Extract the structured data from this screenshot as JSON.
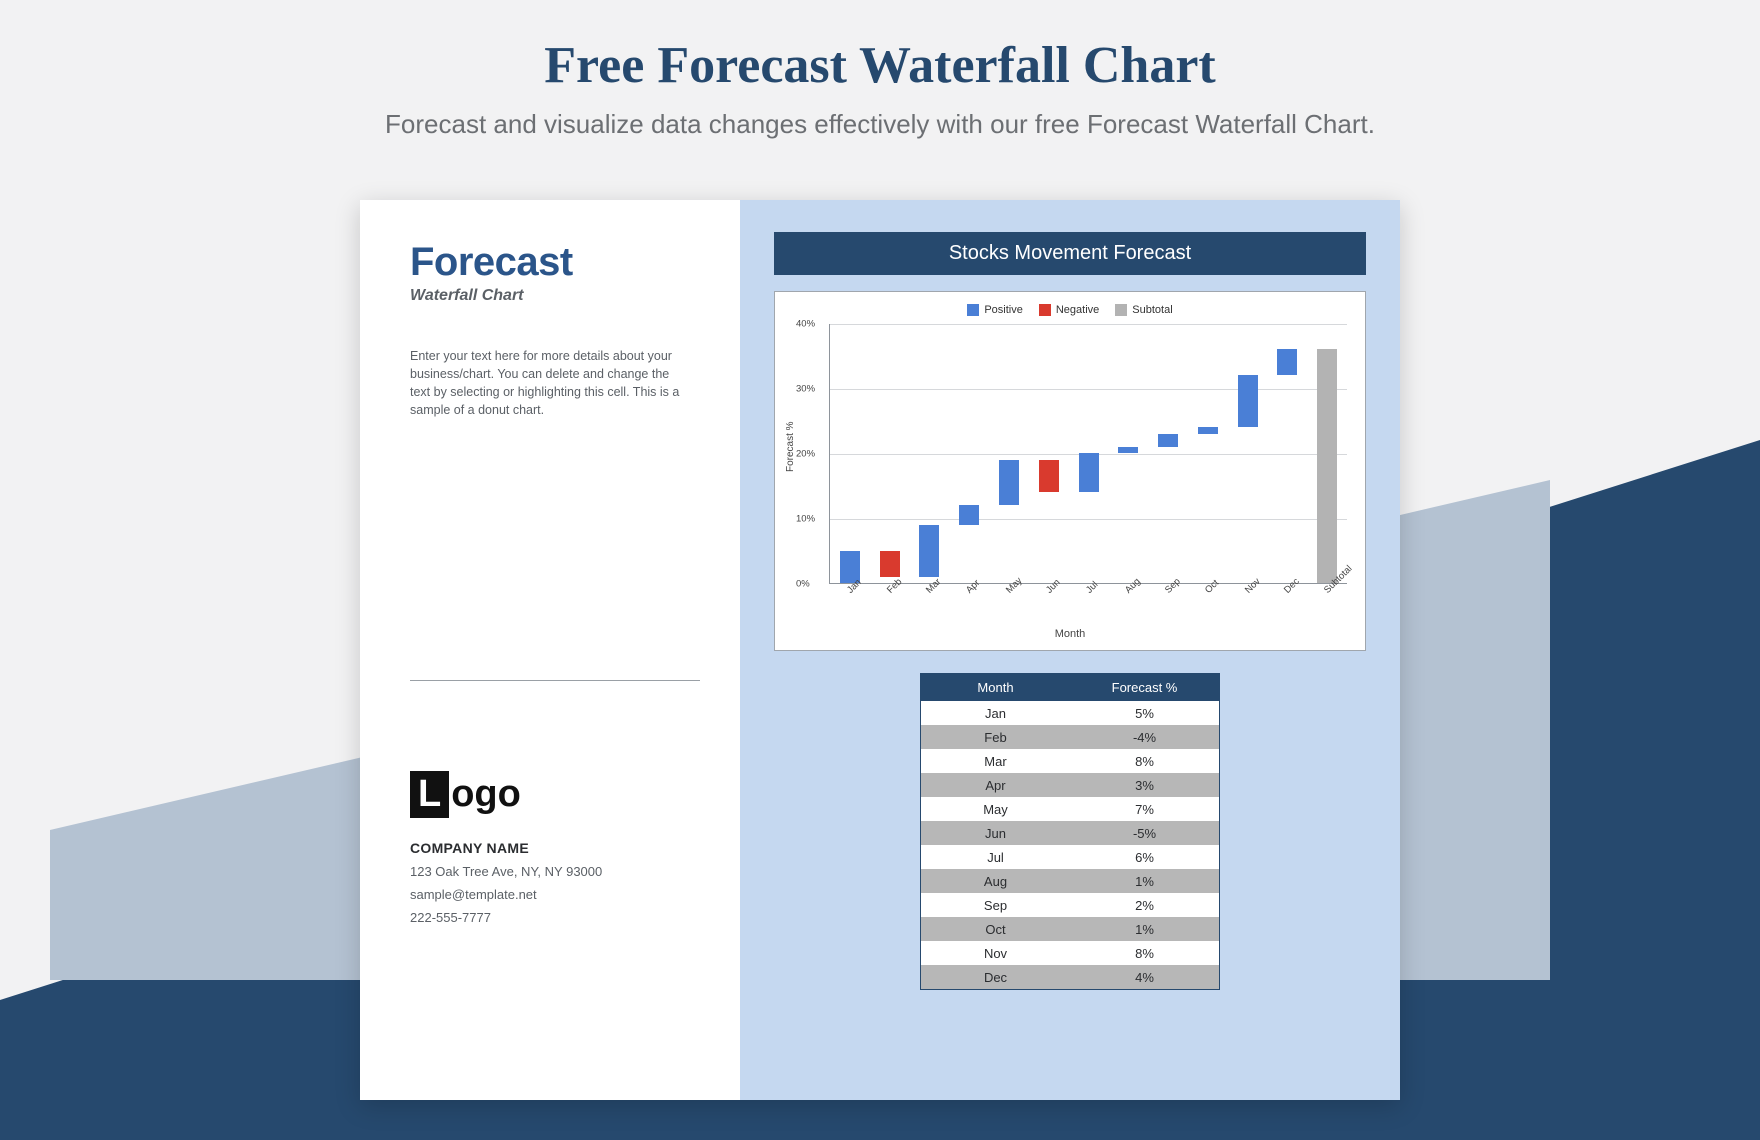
{
  "page": {
    "title": "Free Forecast Waterfall Chart",
    "subtitle": "Forecast and visualize data changes effectively with our free Forecast Waterfall Chart."
  },
  "left": {
    "title": "Forecast",
    "subtitle": "Waterfall Chart",
    "description": "Enter your text here for more details about your business/chart. You can delete and change the text by selecting or highlighting this cell. This is a sample of a donut chart.",
    "logo_l": "L",
    "logo_rest": "ogo",
    "company_name": "COMPANY NAME",
    "address": "123 Oak Tree Ave, NY, NY 93000",
    "email": "sample@template.net",
    "phone": "222-555-7777"
  },
  "chart": {
    "title": "Stocks Movement Forecast",
    "legend": {
      "positive": "Positive",
      "negative": "Negative",
      "subtotal": "Subtotal"
    },
    "ylabel": "Forecast %",
    "xlabel": "Month",
    "yticks": [
      "0%",
      "10%",
      "20%",
      "30%",
      "40%"
    ]
  },
  "table": {
    "headers": [
      "Month",
      "Forecast %"
    ],
    "rows": [
      [
        "Jan",
        "5%"
      ],
      [
        "Feb",
        "-4%"
      ],
      [
        "Mar",
        "8%"
      ],
      [
        "Apr",
        "3%"
      ],
      [
        "May",
        "7%"
      ],
      [
        "Jun",
        "-5%"
      ],
      [
        "Jul",
        "6%"
      ],
      [
        "Aug",
        "1%"
      ],
      [
        "Sep",
        "2%"
      ],
      [
        "Oct",
        "1%"
      ],
      [
        "Nov",
        "8%"
      ],
      [
        "Dec",
        "4%"
      ]
    ]
  },
  "chart_data": {
    "type": "bar",
    "subtype": "waterfall",
    "title": "Stocks Movement Forecast",
    "xlabel": "Month",
    "ylabel": "Forecast %",
    "ylim": [
      0,
      40
    ],
    "categories": [
      "Jan",
      "Feb",
      "Mar",
      "Apr",
      "May",
      "Jun",
      "Jul",
      "Aug",
      "Sep",
      "Oct",
      "Nov",
      "Dec",
      "Subtotal"
    ],
    "values": [
      5,
      -4,
      8,
      3,
      7,
      -5,
      6,
      1,
      2,
      1,
      8,
      4,
      36
    ],
    "bar_type": [
      "positive",
      "negative",
      "positive",
      "positive",
      "positive",
      "negative",
      "positive",
      "positive",
      "positive",
      "positive",
      "positive",
      "positive",
      "subtotal"
    ],
    "legend": [
      "Positive",
      "Negative",
      "Subtotal"
    ],
    "colors": {
      "positive": "#4a7fd6",
      "negative": "#d93a2e",
      "subtotal": "#b3b3b3"
    }
  }
}
